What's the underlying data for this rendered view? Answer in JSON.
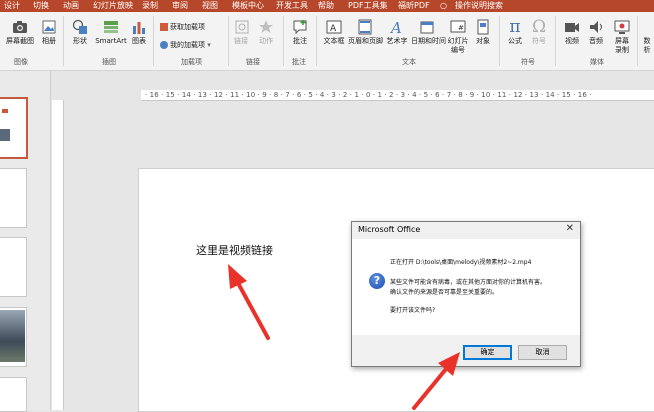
{
  "tabs": [
    "设计",
    "切换",
    "动画",
    "幻灯片放映",
    "录制",
    "审阅",
    "视图",
    "模板中心",
    "开发工具",
    "帮助",
    "PDF工具集",
    "福昕PDF",
    "操作说明搜索"
  ],
  "ribbon": {
    "screenshot": "屏幕截图",
    "album": "相册",
    "shapes": "形状",
    "smartart": "SmartArt",
    "chart": "图表",
    "get_addins": "获取加载项",
    "my_addins": "我的加载项",
    "link": "链接",
    "action": "动作",
    "comment": "批注",
    "textbox": "文本框",
    "header_footer": "页眉和页脚",
    "wordart": "艺术字",
    "datetime": "日期和时间",
    "slide_number_1": "幻灯片",
    "slide_number_2": "编号",
    "object": "对象",
    "equation": "公式",
    "symbol": "符号",
    "video": "视频",
    "audio": "音频",
    "screen_rec_1": "屏幕",
    "screen_rec_2": "录制",
    "extra_1": "数",
    "extra_2": "析",
    "groups": {
      "images": "图像",
      "illustrations": "插图",
      "addins": "加载项",
      "links": "链接",
      "comments": "批注",
      "text": "文本",
      "symbols": "符号",
      "media": "媒体"
    }
  },
  "ruler": {
    "label": "· 16 · 15 · 14 · 13 · 12 · 11 · 10 · 9 · 8 · 7 · 6 · 5 · 4 · 3 · 2 · 1 · 0 · 1 · 2 · 3 · 4 · 5 · 6 · 7 · 8 · 9 · 10 · 11 · 12 · 13 · 14 · 15 · 16 ·"
  },
  "slide": {
    "text": "这里是视频链接"
  },
  "dialog": {
    "title": "Microsoft Office",
    "close": "✕",
    "icon": "?",
    "line1": "正在打开 D:\\tools\\桌面\\melody\\视频素材2~2.mp4",
    "line2": "某些文件可能含有病毒，或在其他方面对你的计算机有害。",
    "line3": "确认文件的来源是否可靠是至关重要的。",
    "line4": "要打开该文件吗?",
    "ok": "确定",
    "cancel": "取消"
  },
  "colors": {
    "accent": "#b7472a",
    "arrow": "#e8322a"
  }
}
